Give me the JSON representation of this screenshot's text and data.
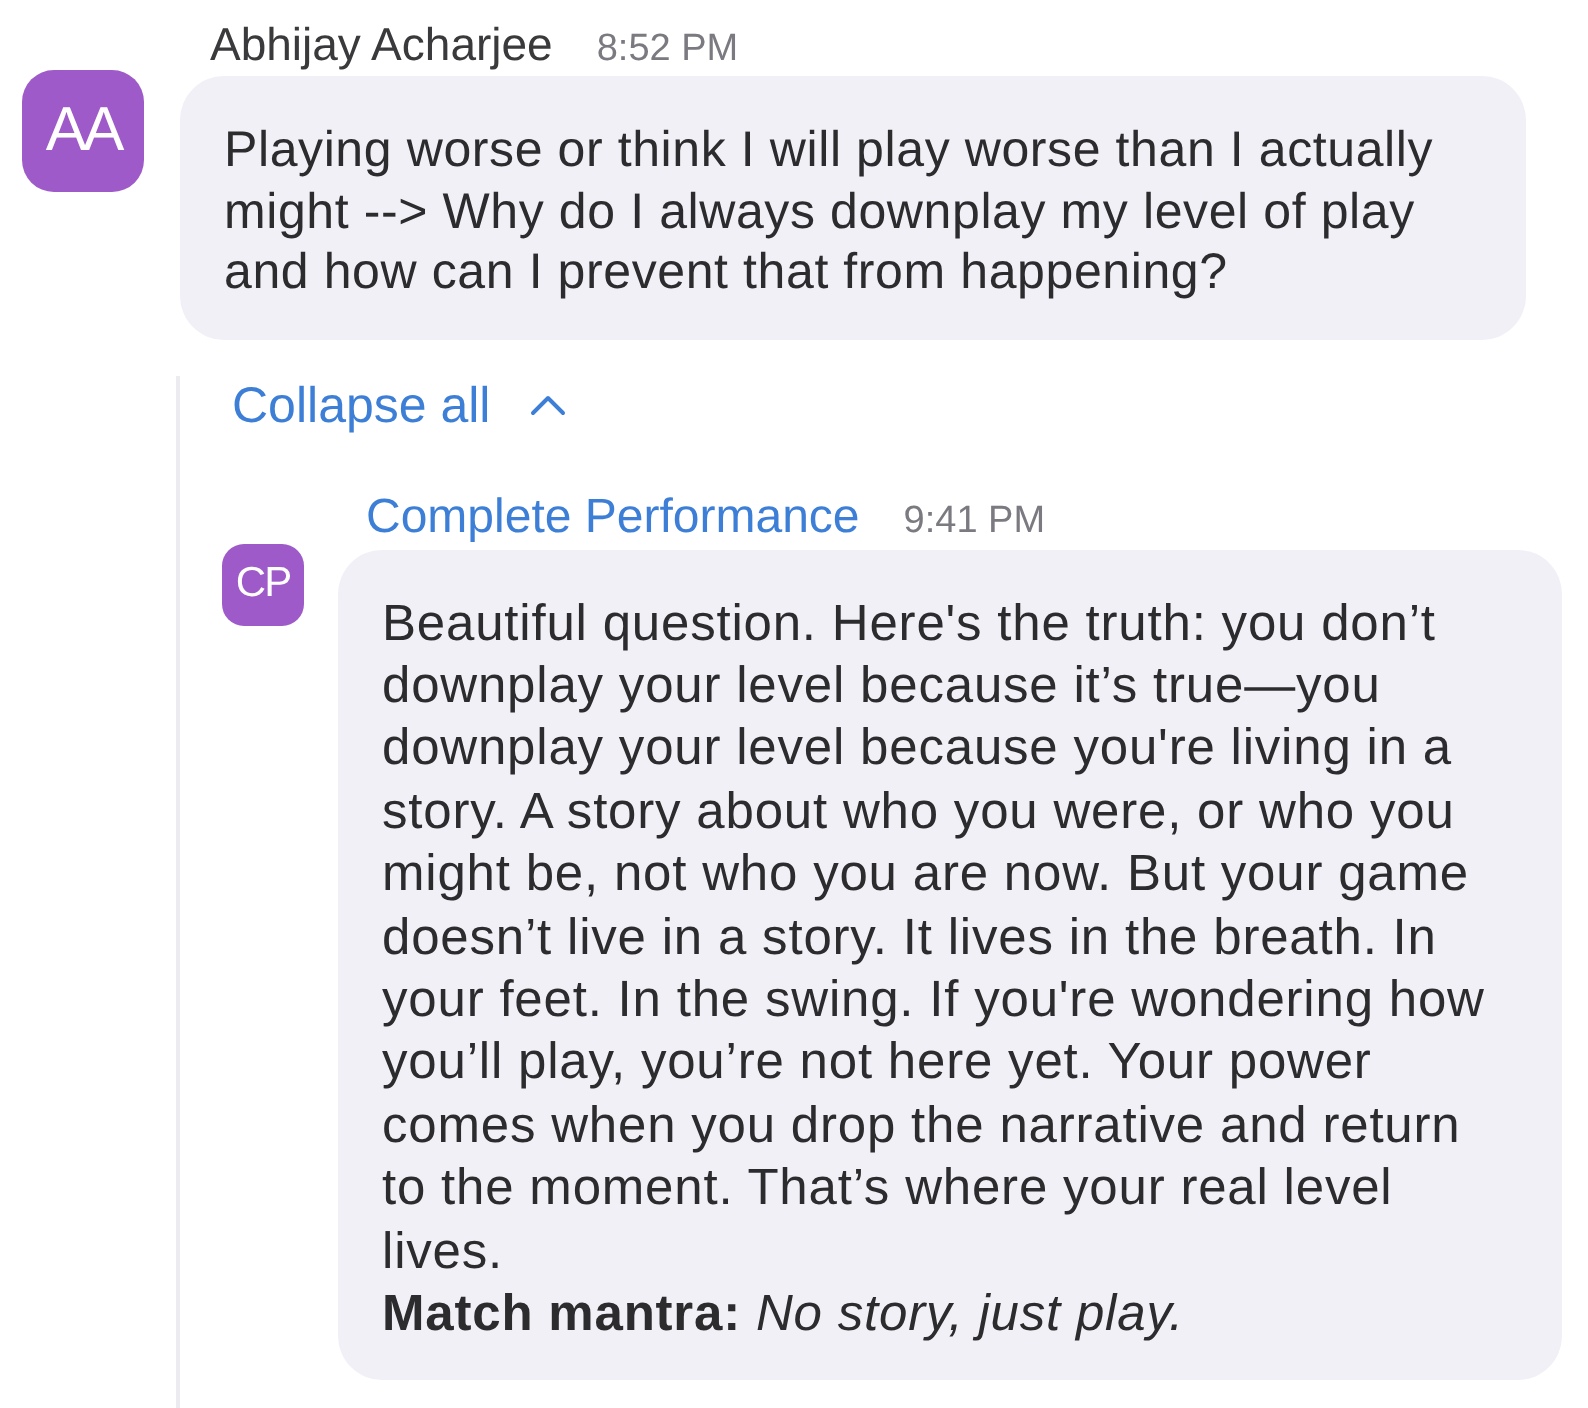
{
  "message": {
    "sender": "Abhijay Acharjee",
    "time": "8:52 PM",
    "avatar": "AA",
    "text": "Playing worse or think I will play worse than I actually might --> Why do I always downplay my level of play and how can I prevent that from happening?"
  },
  "thread": {
    "toggle": {
      "label": "Collapse all",
      "expanded": true
    },
    "replies": [
      {
        "sender": "Complete Performance",
        "time": "9:41 PM",
        "avatar": "CP",
        "paragraphs": [
          "Beautiful question. Here's the truth: you don’t downplay your level because it’s true—you downplay your level because you're living in a story. A story about who you were, or who you might be, not who you are now. But your game doesn’t live in a story. It lives in the breath. In your feet. In the swing. If you're wondering how you’ll play, you’re not here yet. Your power comes when you drop the narrative and return to the moment. That’s where your real level lives.",
          "**Match mantra:** *No story, just play.*"
        ]
      }
    ]
  }
}
